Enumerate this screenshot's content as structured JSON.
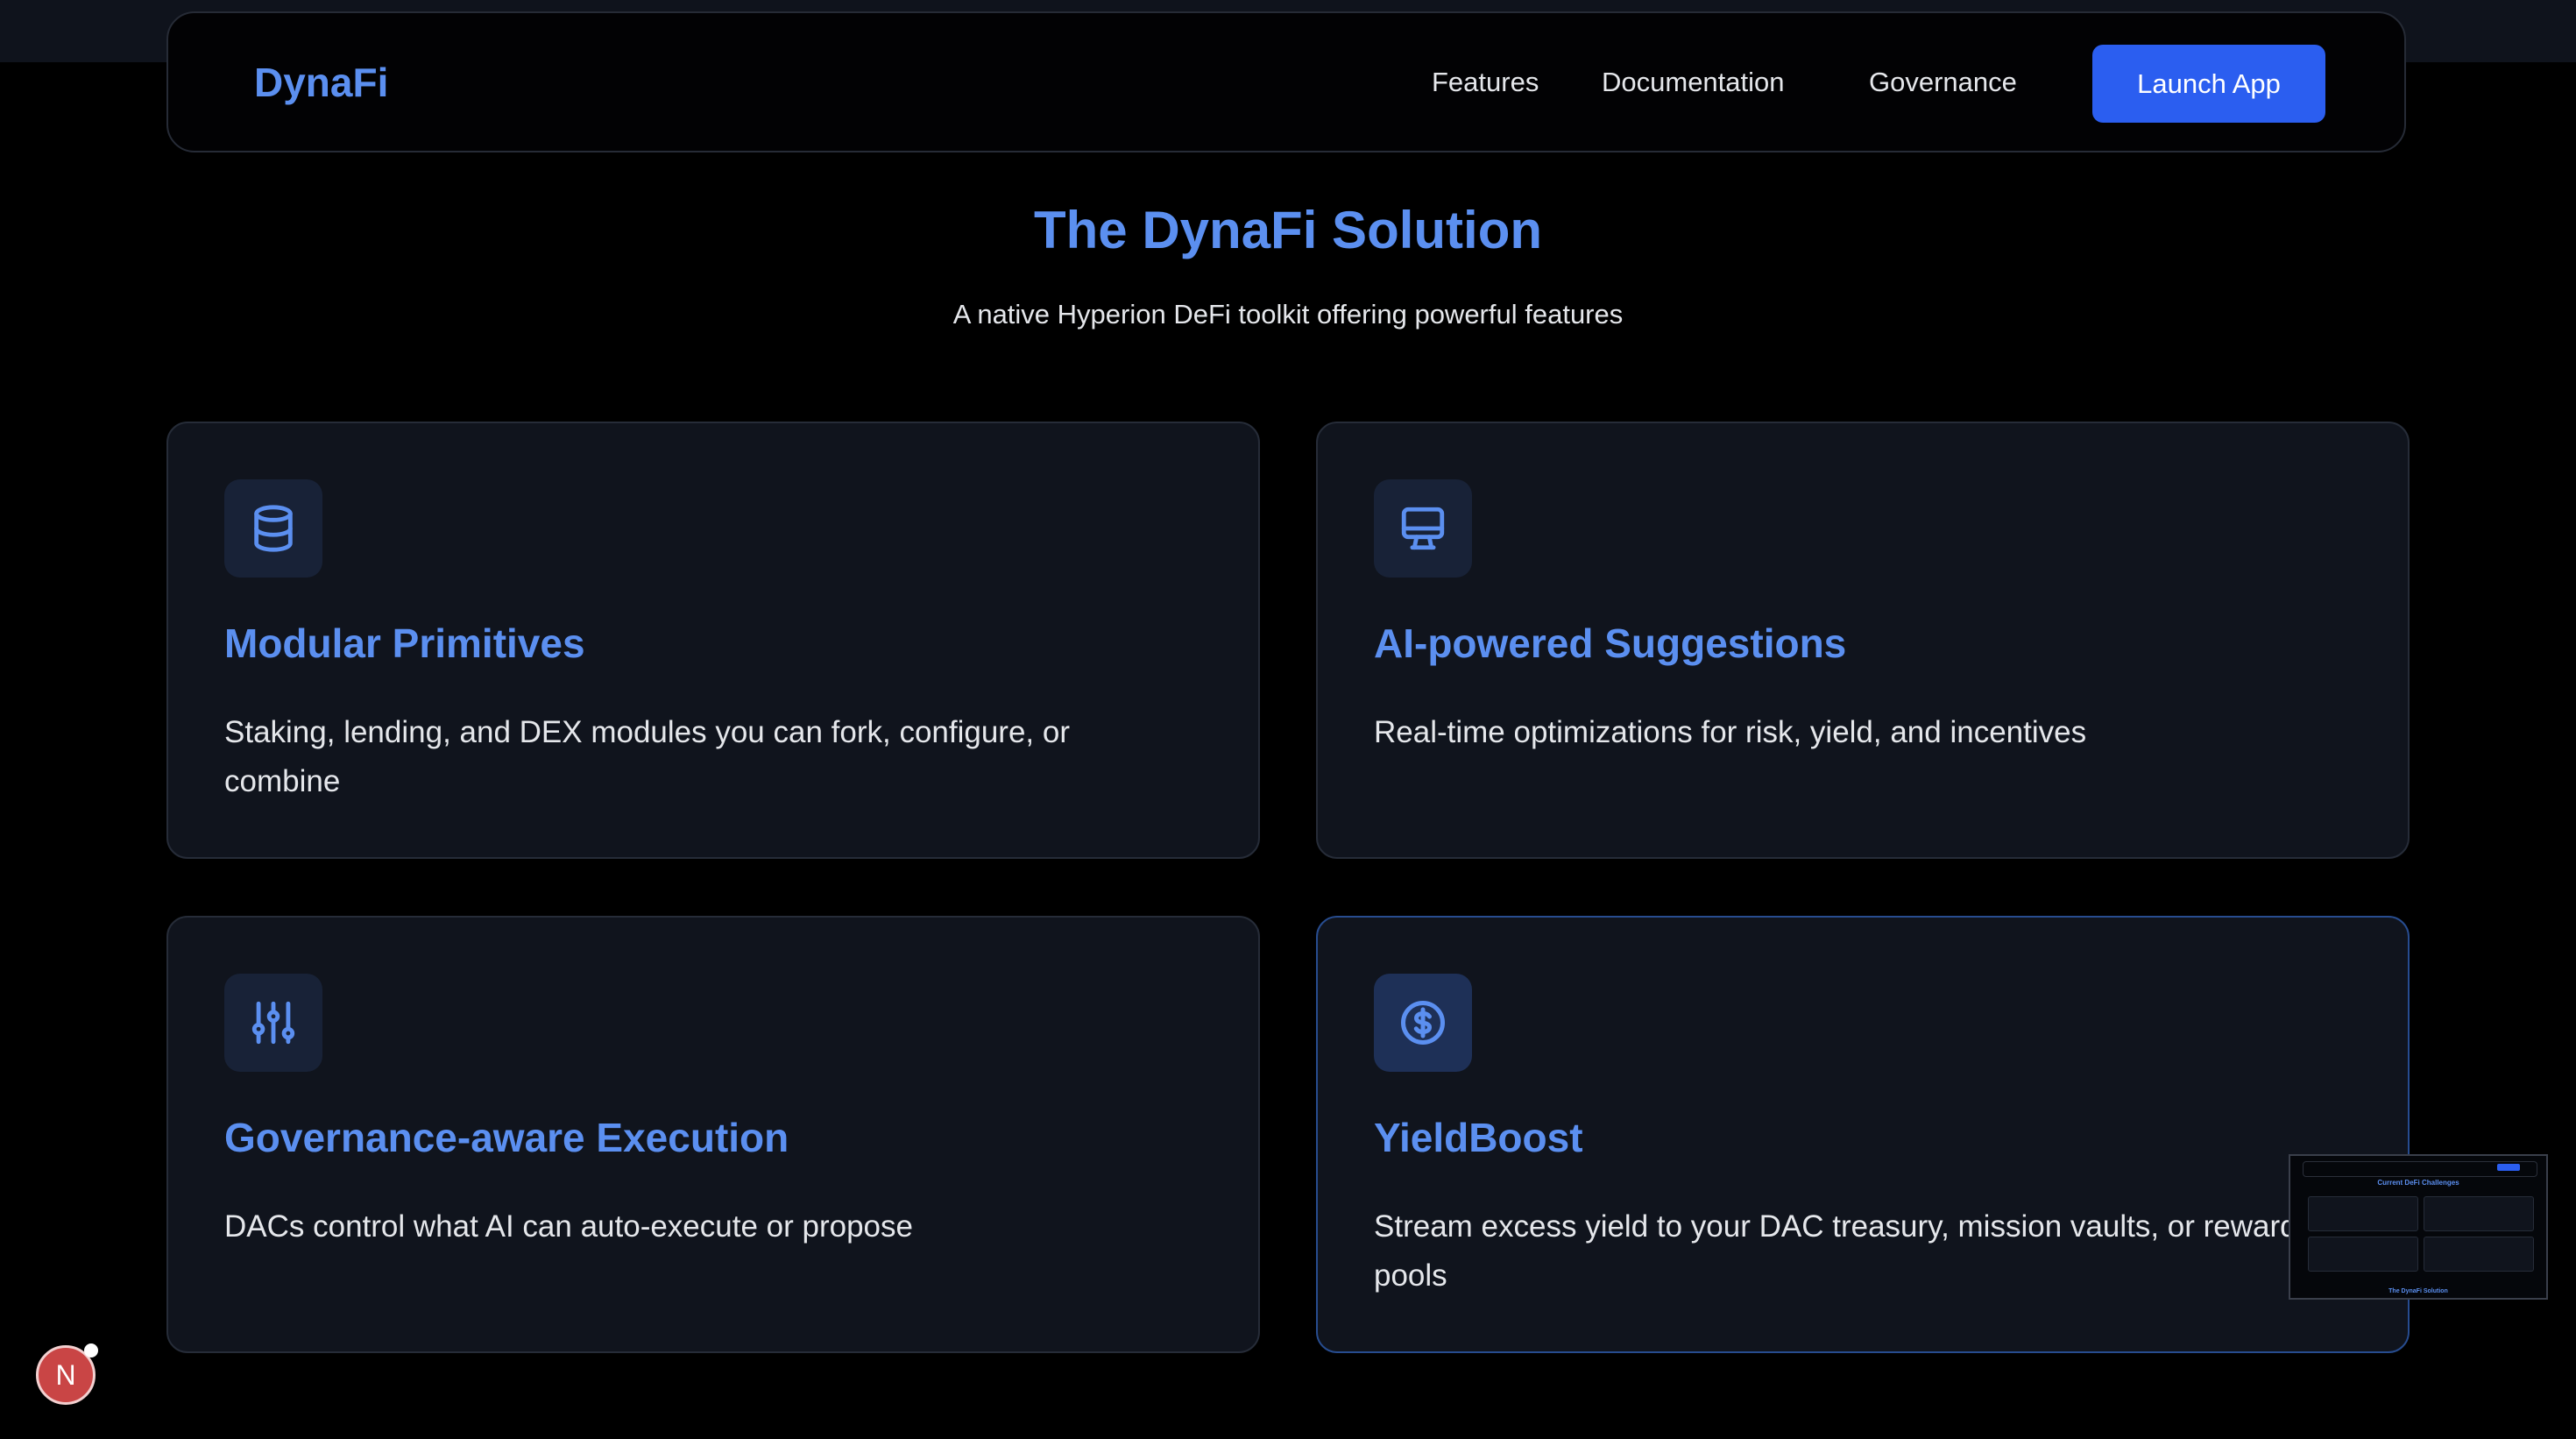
{
  "nav": {
    "brand": "DynaFi",
    "links": [
      "Features",
      "Documentation",
      "Governance"
    ],
    "cta": "Launch App"
  },
  "hero": {
    "title": "The DynaFi Solution",
    "subtitle": "A native Hyperion DeFi toolkit offering powerful features"
  },
  "features": [
    {
      "icon": "database-icon",
      "title": "Modular Primitives",
      "description": "Staking, lending, and DEX modules you can fork, configure, or combine"
    },
    {
      "icon": "monitor-icon",
      "title": "AI-powered Suggestions",
      "description": "Real-time optimizations for risk, yield, and incentives"
    },
    {
      "icon": "sliders-icon",
      "title": "Governance-aware Execution",
      "description": "DACs control what AI can auto-execute or propose"
    },
    {
      "icon": "dollar-circle-icon",
      "title": "YieldBoost",
      "description": "Stream excess yield to your DAC treasury, mission vaults, or reward pools"
    }
  ],
  "preview": {
    "title": "Current DeFi Challenges",
    "footer": "The DynaFi Solution"
  },
  "dev_badge": "N",
  "colors": {
    "accent": "#5b8ff0",
    "button": "#2b5ef0",
    "card_bg": "#10141d",
    "page_bg": "#000000"
  }
}
